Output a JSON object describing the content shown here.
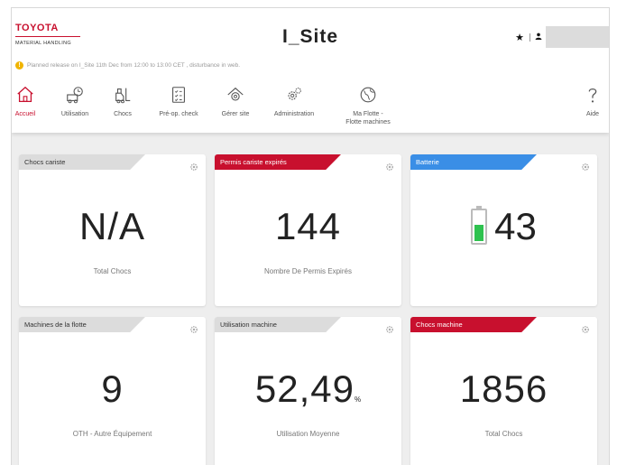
{
  "brand": {
    "name": "TOYOTA",
    "subtitle": "MATERIAL HANDLING",
    "color": "#c8102e"
  },
  "site_title": "I_Site",
  "notice": {
    "icon": "warning-icon",
    "text": "Planned release on I_Site 11th Dec from 12:00 to 13:00 CET , disturbance in web."
  },
  "header_actions": {
    "favorite_icon": "star-icon",
    "user_icon": "user-icon"
  },
  "nav": [
    {
      "label": "Accueil",
      "icon": "home-icon",
      "active": true
    },
    {
      "label": "Utilisation",
      "icon": "utilisation-icon"
    },
    {
      "label": "Chocs",
      "icon": "forklift-icon"
    },
    {
      "label": "Pré-op. check",
      "icon": "checklist-icon"
    },
    {
      "label": "Gérer site",
      "icon": "site-icon"
    },
    {
      "label": "Administration",
      "icon": "admin-gear-icon"
    },
    {
      "label": "Ma Flotte -",
      "label2": "Flotte machines",
      "icon": "globe-icon"
    },
    {
      "label": "Aide",
      "icon": "help-icon"
    }
  ],
  "cards": [
    {
      "tag": "Chocs cariste",
      "tag_style": "grey",
      "value": "N/A",
      "caption": "Total Chocs"
    },
    {
      "tag": "Permis cariste expirés",
      "tag_style": "red",
      "value": "144",
      "caption": "Nombre De Permis Expirés"
    },
    {
      "tag": "Batterie",
      "tag_style": "blue",
      "value": "43",
      "caption": "",
      "battery_level": 0.6
    },
    {
      "tag": "Machines de la flotte",
      "tag_style": "grey",
      "value": "9",
      "caption": "OTH - Autre Équipement"
    },
    {
      "tag": "Utilisation machine",
      "tag_style": "grey",
      "value": "52,49",
      "unit": "%",
      "caption": "Utilisation Moyenne"
    },
    {
      "tag": "Chocs machine",
      "tag_style": "red",
      "value": "1856",
      "caption": "Total Chocs"
    }
  ],
  "colors": {
    "accent_red": "#c8102e",
    "accent_blue": "#3a8ee6",
    "battery_green": "#2ec24f",
    "tag_grey": "#dcdcdc"
  }
}
